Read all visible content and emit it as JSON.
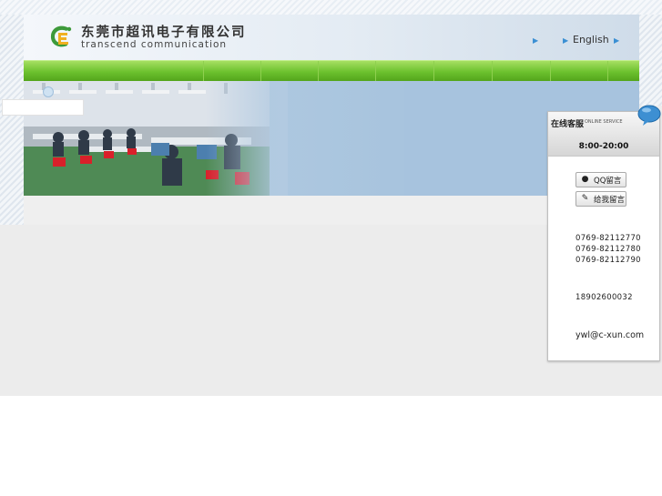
{
  "header": {
    "company_cn": "东莞市超讯电子有限公司",
    "company_en": "transcend communication",
    "lang_link": "English"
  },
  "nav": {
    "item_count": 9
  },
  "customer_service": {
    "title_cn": "在线客服",
    "title_en": "ONLINE SERVICE",
    "hours": "8:00-20:00",
    "qq_button": "QQ留言",
    "message_button": "给我留言",
    "phones": [
      "0769-82112770",
      "0769-82112780",
      "0769-82112790"
    ],
    "mobile": "18902600032",
    "email": "ywl@c-xun.com"
  },
  "colors": {
    "nav_green": "#6cc12e",
    "banner_blue": "#a8c4de",
    "accent_blue": "#3a8fd3",
    "logo_green": "#3d9a3a"
  },
  "icons": {
    "logo": "dragon-logo-icon",
    "arrow": "arrow-right-icon",
    "bubble": "chat-bubble-icon",
    "qq": "qq-penguin-icon",
    "pen": "pen-icon"
  }
}
